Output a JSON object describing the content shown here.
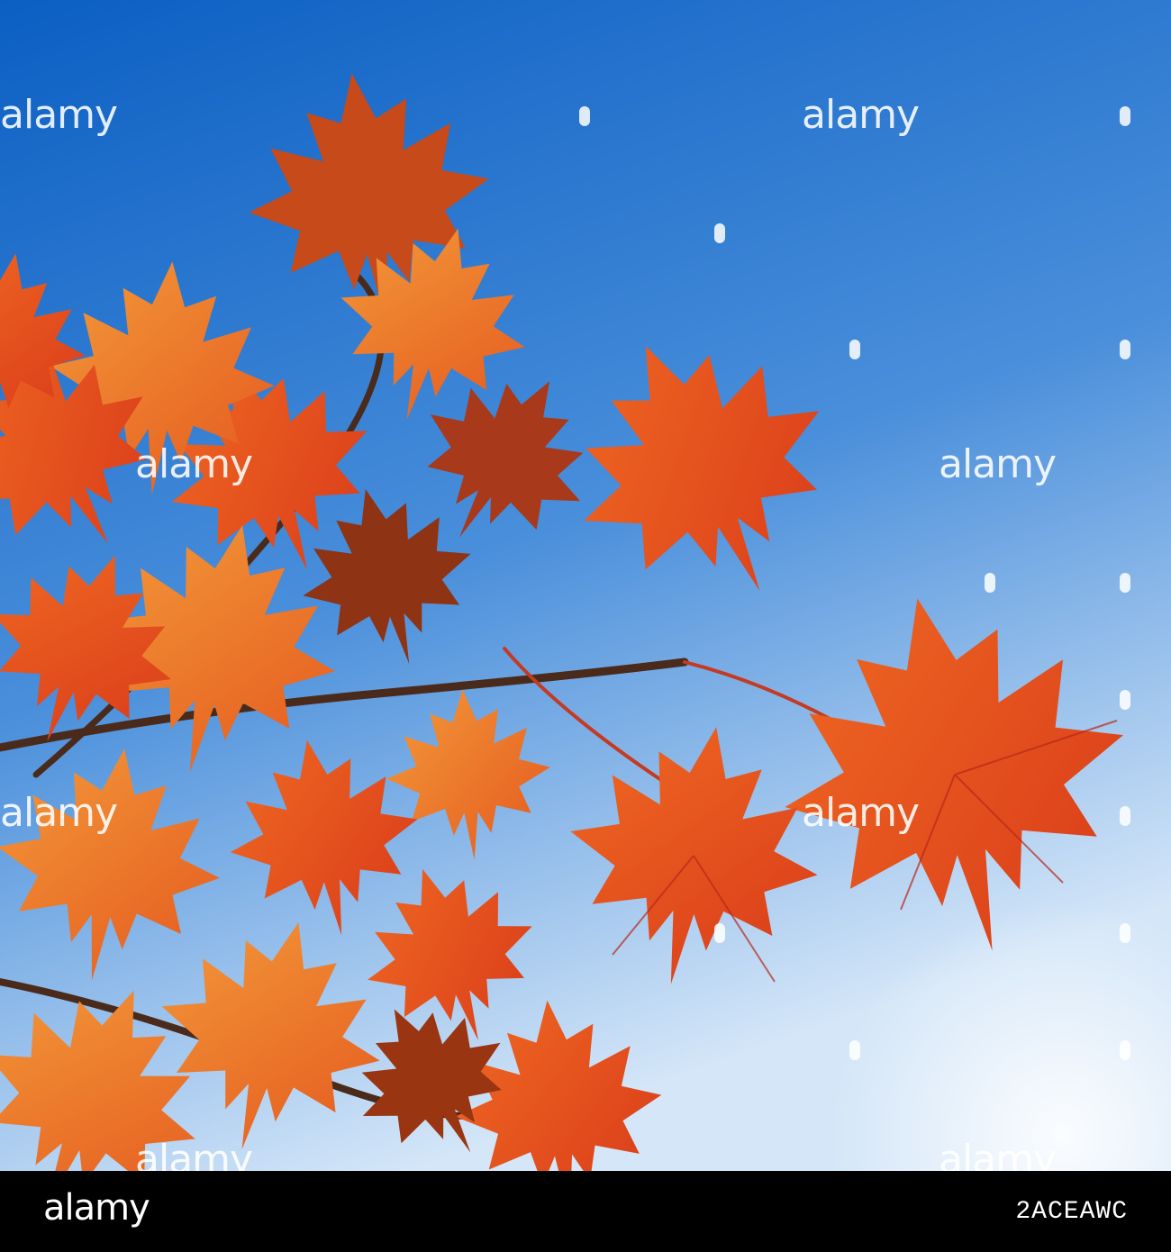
{
  "photo": {
    "subject": "red-orange maple leaves backlit against blue sky",
    "colors": {
      "sky_top": "#0d62c4",
      "sky_bottom": "#cfe2f6",
      "leaf_red": "#e9471c",
      "leaf_orange": "#f27a2a",
      "leaf_shadow": "#9a3512",
      "branch": "#4a2a1a"
    }
  },
  "watermark": {
    "text": "alamy"
  },
  "footer": {
    "logo": "alamy",
    "image_code": "2ACEAWC"
  }
}
